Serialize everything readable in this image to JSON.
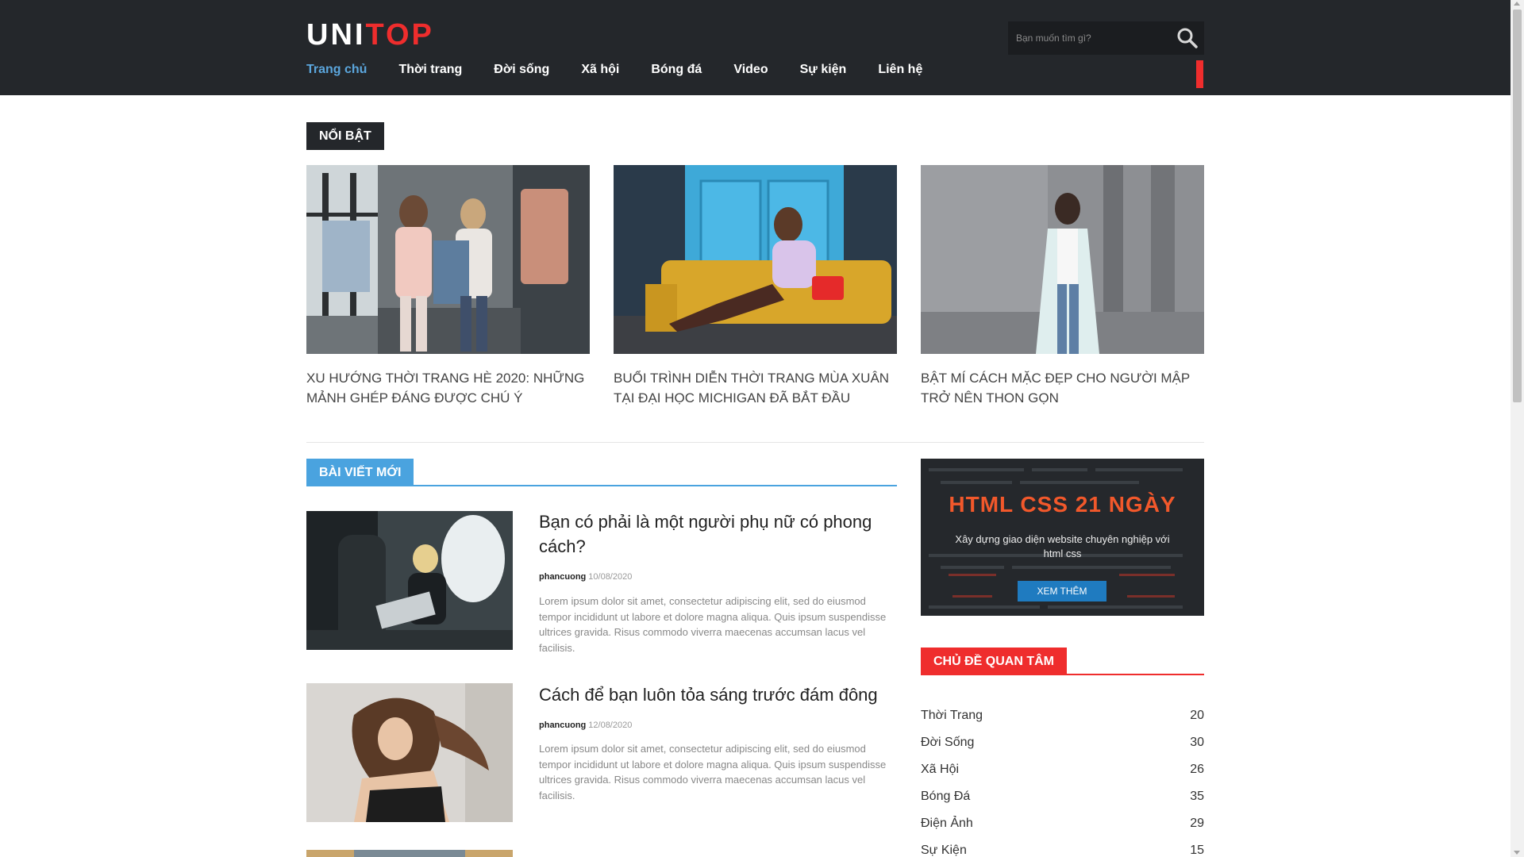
{
  "header": {
    "logo_part1": "UNI",
    "logo_part2": "TOP",
    "search": {
      "placeholder": "Bạn muốn tìm gì?",
      "icon": "search-icon"
    },
    "nav": [
      {
        "label": "Trang chủ",
        "active": true
      },
      {
        "label": "Thời trang"
      },
      {
        "label": "Đời sống"
      },
      {
        "label": "Xã hội"
      },
      {
        "label": "Bóng đá"
      },
      {
        "label": "Video"
      },
      {
        "label": "Sự kiện"
      },
      {
        "label": "Liên hệ"
      }
    ]
  },
  "featured": {
    "label": "NỔI BẬT",
    "items": [
      {
        "title": "XU HƯỚNG THỜI TRANG HÈ 2020: NHỮNG MẢNH GHÉP ĐÁNG ĐƯỢC CHÚ Ý"
      },
      {
        "title": "BUỔI TRÌNH DIỄN THỜI TRANG MÙA XUÂN TẠI ĐẠI HỌC MICHIGAN ĐÃ BẮT ĐẦU"
      },
      {
        "title": "BẬT MÍ CÁCH MẶC ĐẸP CHO NGƯỜI MẬP TRỞ NÊN THON GỌN"
      }
    ]
  },
  "latest": {
    "label": "BÀI VIẾT MỚI",
    "posts": [
      {
        "title": "Bạn có phải là một người phụ nữ có phong cách?",
        "author": "phancuong",
        "date": "10/08/2020",
        "excerpt": "Lorem ipsum dolor sit amet, consectetur adipiscing elit, sed do eiusmod tempor incididunt ut labore et dolore magna aliqua. Quis ipsum suspendisse ultrices gravida. Risus commodo viverra maecenas accumsan lacus vel facilisis."
      },
      {
        "title": "Cách để bạn luôn tỏa sáng trước đám đông",
        "author": "phancuong",
        "date": "12/08/2020",
        "excerpt": "Lorem ipsum dolor sit amet, consectetur adipiscing elit, sed do eiusmod tempor incididunt ut labore et dolore magna aliqua. Quis ipsum suspendisse ultrices gravida. Risus commodo viverra maecenas accumsan lacus vel facilisis."
      }
    ]
  },
  "banner": {
    "title": "HTML CSS 21 NGÀY",
    "subtitle": "Xây dựng giao diện website chuyên nghiệp với html css",
    "button": "XEM THÊM"
  },
  "topics": {
    "label": "CHỦ ĐỀ QUAN TÂM",
    "items": [
      {
        "name": "Thời Trang",
        "count": "20"
      },
      {
        "name": "Đời Sống",
        "count": "30"
      },
      {
        "name": "Xã Hội",
        "count": "26"
      },
      {
        "name": "Bóng Đá",
        "count": "35"
      },
      {
        "name": "Điện Ảnh",
        "count": "29"
      },
      {
        "name": "Sự Kiện",
        "count": "15"
      }
    ]
  },
  "colors": {
    "header_bg": "#24272b",
    "accent_blue": "#4aa3df",
    "accent_red": "#ef2d2d"
  }
}
